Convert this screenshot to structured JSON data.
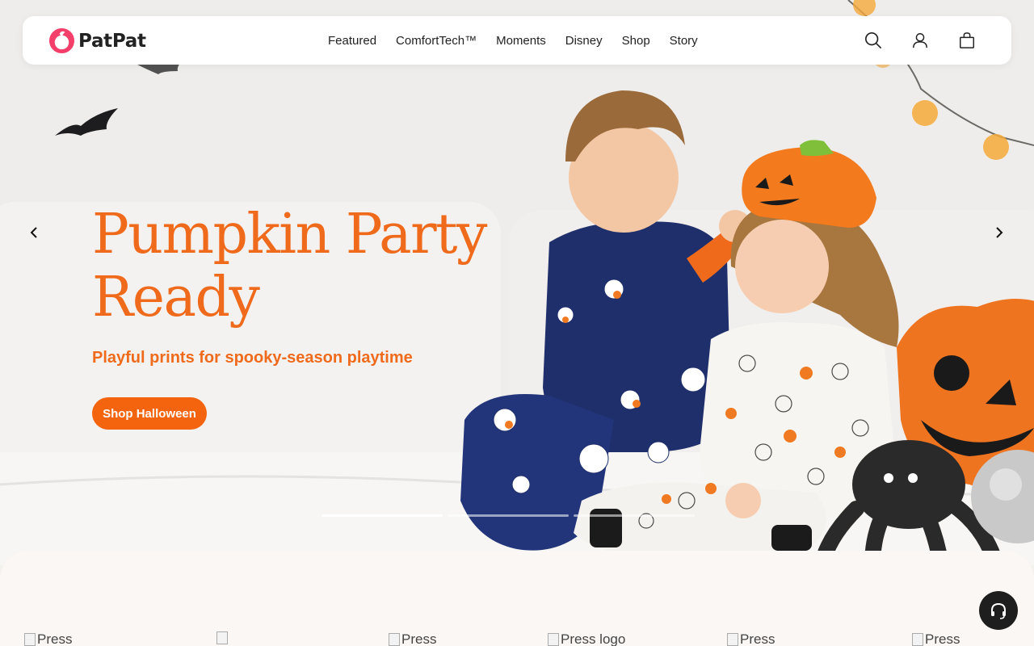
{
  "header": {
    "logo_text": "PatPat",
    "nav": [
      "Featured",
      "ComfortTech™",
      "Moments",
      "Disney",
      "Shop",
      "Story"
    ],
    "icons": [
      "search-icon",
      "account-icon",
      "bag-icon"
    ]
  },
  "hero": {
    "title_line1": "Pumpkin Party",
    "title_line2": "Ready",
    "subtitle": "Playful prints for spooky-season playtime",
    "cta_label": "Shop Halloween",
    "slide_count": 3,
    "active_slide": 1
  },
  "press": {
    "items": [
      "Press",
      "",
      "Press",
      "Press logo",
      "Press",
      "Press"
    ]
  },
  "colors": {
    "accent": "#f06a1c",
    "button": "#f4640f",
    "text": "#222222"
  }
}
